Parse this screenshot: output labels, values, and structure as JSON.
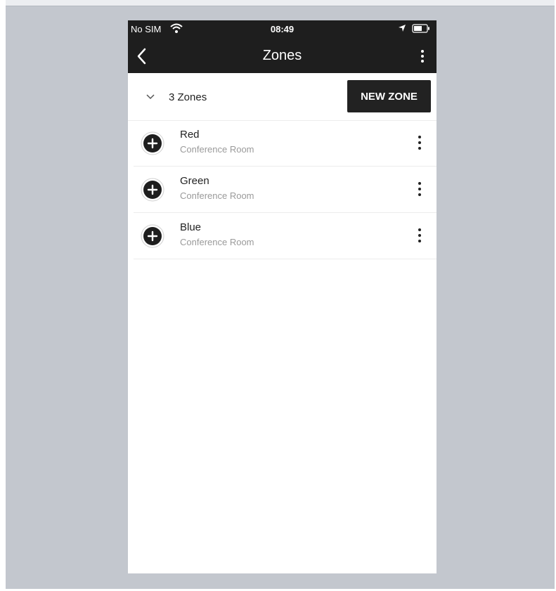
{
  "status_bar": {
    "carrier": "No SIM",
    "time": "08:49"
  },
  "app_bar": {
    "title": "Zones"
  },
  "summary": {
    "count_label": "3 Zones",
    "new_zone_label": "NEW ZONE"
  },
  "zones": [
    {
      "name": "Red",
      "room": "Conference Room"
    },
    {
      "name": "Green",
      "room": "Conference Room"
    },
    {
      "name": "Blue",
      "room": "Conference Room"
    }
  ],
  "colors": {
    "bar_background": "#1e1e1e",
    "button_background": "#222222",
    "frame_background": "#c3c7ce",
    "secondary_text": "#9a9a9a"
  },
  "icons": {
    "back": "back-arrow-icon",
    "overflow": "more-vertical-icon",
    "expand": "chevron-down-icon",
    "add": "plus-circle-icon",
    "item_menu": "more-vertical-icon"
  }
}
